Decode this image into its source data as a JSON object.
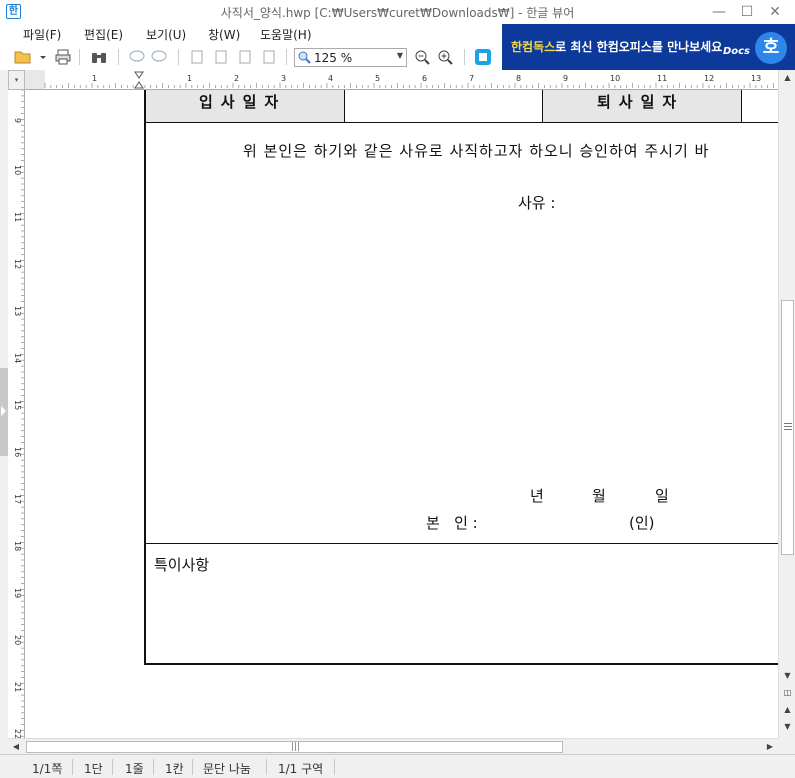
{
  "window": {
    "title": "사직서_양식.hwp [C:₩Users₩curet₩Downloads₩] - 한글 뷰어",
    "app_icon": "한",
    "minimize": "—",
    "maximize": "☐",
    "close": "✕"
  },
  "menu": {
    "file": "파일(F)",
    "edit": "편집(E)",
    "view": "보기(U)",
    "window": "창(W)",
    "help": "도움말(H)"
  },
  "toolbar": {
    "zoom_value": "125 %"
  },
  "banner": {
    "highlight": "한컴독스",
    "text": "로 최신 한컴오피스를 만나보세요",
    "docs_label": "Docs",
    "logo": "호"
  },
  "ruler": {
    "horizontal_numbers": [
      "1",
      "1",
      "2",
      "3",
      "4",
      "5",
      "6",
      "7",
      "8",
      "9",
      "10",
      "11",
      "12",
      "13"
    ],
    "vertical_numbers": [
      "9",
      "10",
      "11",
      "12",
      "13",
      "14",
      "15",
      "16",
      "17",
      "18",
      "19",
      "20",
      "21",
      "22"
    ]
  },
  "document": {
    "join_date_label": "입사일자",
    "leave_date_label": "퇴사일자",
    "statement": "위 본인은 하기와 같은 사유로 사직하고자 하오니 승인하여 주시기 바",
    "reason_label": "사유 :",
    "date_year": "년",
    "date_month": "월",
    "date_day": "일",
    "signer_label": "본   인 :",
    "seal": "(인)",
    "remarks_label": "특이사항"
  },
  "status": {
    "page": "1/1쪽",
    "column": "1단",
    "line": "1줄",
    "cell": "1칸",
    "paragraph": "문단 나눔",
    "section": "1/1 구역"
  },
  "colors": {
    "accent": "#1e7fd6",
    "banner_bg": "#0d3a9a",
    "banner_highlight": "#f6d648",
    "header_cell_gray": "#e6e6e6"
  }
}
